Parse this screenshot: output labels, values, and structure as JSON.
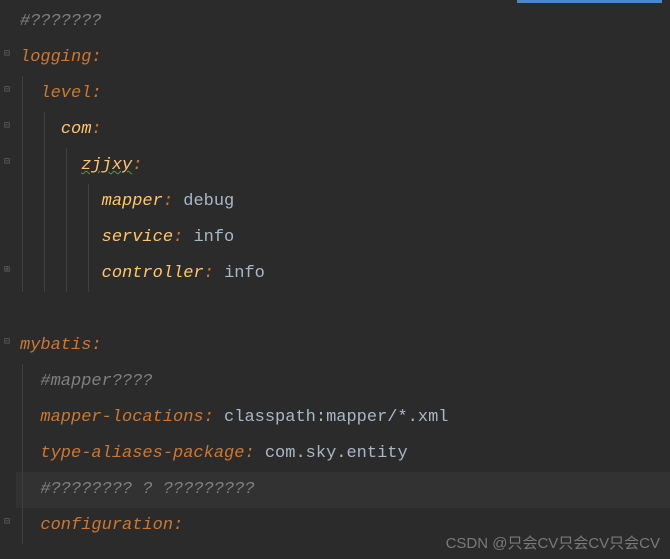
{
  "lines": {
    "l1_comment": "#???????",
    "l2_key": "logging",
    "l3_key": "level",
    "l4_key": "com",
    "l5_key": "zjjxy",
    "l6_key": "mapper",
    "l6_value": "debug",
    "l7_key": "service",
    "l7_value": "info",
    "l8_key": "controller",
    "l8_value": "info",
    "l10_key": "mybatis",
    "l11_comment": "#mapper????",
    "l12_key": "mapper-locations",
    "l12_value": "classpath:mapper/*.xml",
    "l13_key": "type-aliases-package",
    "l13_value": "com.sky.entity",
    "l14_comment": "#???????? ? ?????????",
    "l15_key": "configuration"
  },
  "watermark": "CSDN @只会CV只会CV只会CV",
  "colon": ":",
  "space": " "
}
